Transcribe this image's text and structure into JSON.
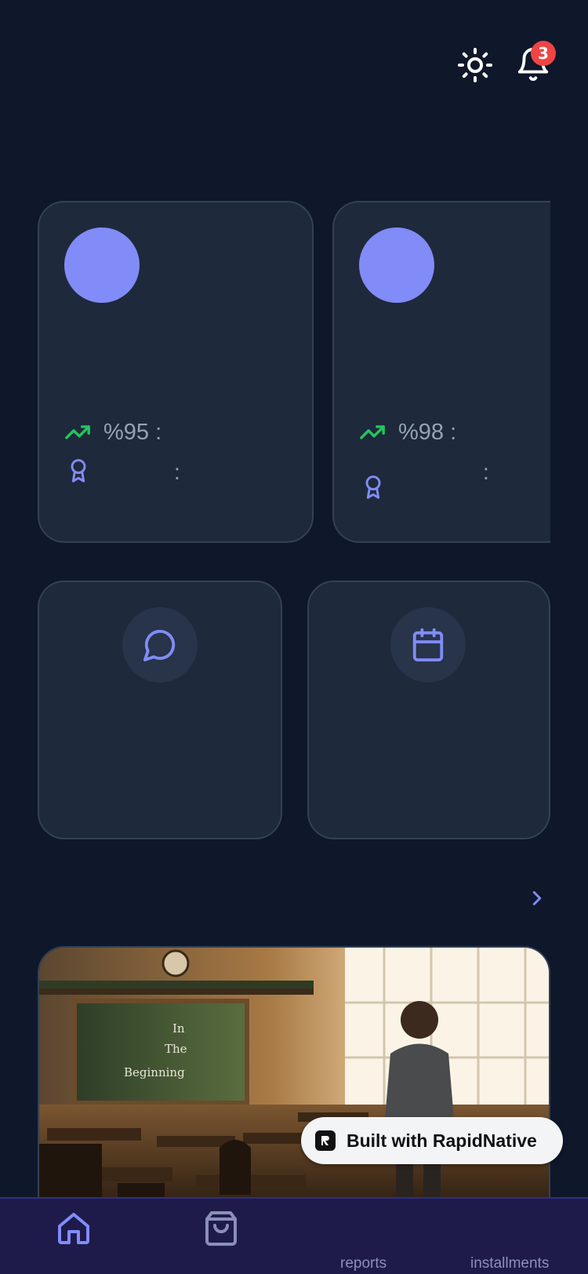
{
  "header": {
    "theme_icon": "sun-icon",
    "notifications_icon": "bell-icon",
    "notification_count": "3"
  },
  "summary_cards": [
    {
      "stat_text": "%95 :",
      "award_colon": ":"
    },
    {
      "stat_text": "%98 :",
      "award_colon": ":"
    }
  ],
  "action_cards": [
    {
      "icon": "message-circle-icon"
    },
    {
      "icon": "calendar-icon"
    }
  ],
  "section": {
    "more_icon": "chevron-right-icon"
  },
  "banner": {
    "image": "classroom-photo",
    "chalkboard_text": "In The Beginning"
  },
  "built_with": {
    "label": "Built with RapidNative"
  },
  "nav": {
    "items": [
      {
        "icon": "home-icon",
        "label": ""
      },
      {
        "icon": "shopping-bag-icon",
        "label": ""
      },
      {
        "icon": "",
        "label": "reports"
      },
      {
        "icon": "",
        "label": "installments"
      }
    ]
  },
  "colors": {
    "background": "#0f172a",
    "card": "#1e293b",
    "accent": "#818cf8",
    "trend_up": "#22c55e",
    "badge": "#ef4444",
    "nav_background": "#1e1b4b"
  }
}
